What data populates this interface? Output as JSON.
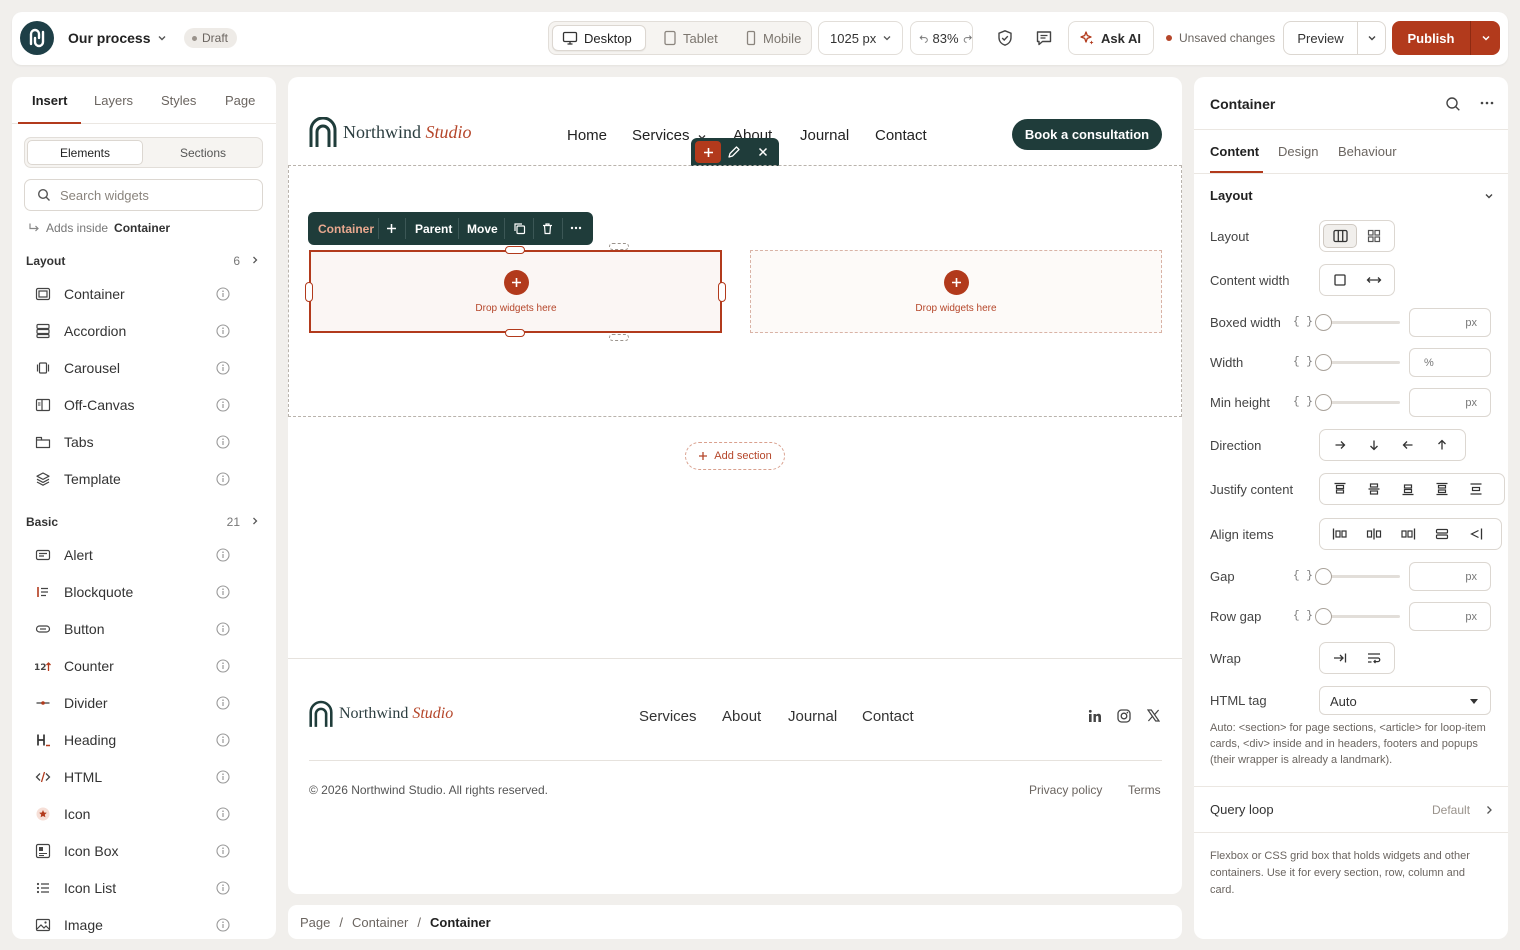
{
  "app": {
    "doc_title": "Our process",
    "status_badge": "Draft",
    "devices": [
      "Desktop",
      "Tablet",
      "Mobile"
    ],
    "width_value": "1025 px",
    "zoom": "83%",
    "ask_ai": "Ask AI",
    "unsaved": "Unsaved changes",
    "preview": "Preview",
    "publish": "Publish"
  },
  "left": {
    "tabs": [
      "Insert",
      "Layers",
      "Styles",
      "Page"
    ],
    "segments": [
      "Elements",
      "Sections"
    ],
    "search_placeholder": "Search widgets",
    "adds_inside_prefix": "Adds inside",
    "adds_inside_target": "Container",
    "layout_category": {
      "label": "Layout",
      "count": "6"
    },
    "layout_items": [
      "Container",
      "Accordion",
      "Carousel",
      "Off-Canvas",
      "Tabs",
      "Template"
    ],
    "basic_category": {
      "label": "Basic",
      "count": "21"
    },
    "basic_items": [
      "Alert",
      "Blockquote",
      "Button",
      "Counter",
      "Divider",
      "Heading",
      "HTML",
      "Icon",
      "Icon Box",
      "Icon List",
      "Image"
    ]
  },
  "site": {
    "brand_main": "Northwind",
    "brand_italic": "Studio",
    "nav": [
      "Home",
      "Services",
      "About",
      "Journal",
      "Contact"
    ],
    "cta": "Book a consultation",
    "toolbar": [
      "Container",
      "Parent",
      "Move"
    ],
    "drop_text": "Drop widgets here",
    "add_section": "Add section",
    "footer_nav": [
      "Services",
      "About",
      "Journal",
      "Contact"
    ],
    "copyright": "© 2026 Northwind Studio. All rights reserved.",
    "privacy": "Privacy policy",
    "terms": "Terms"
  },
  "breadcrumbs": [
    "Page",
    "Container",
    "Container"
  ],
  "right": {
    "title": "Container",
    "tabs": [
      "Content",
      "Design",
      "Behaviour"
    ],
    "section": "Layout",
    "labels": {
      "layout": "Layout",
      "content_width": "Content width",
      "boxed_width": "Boxed width",
      "width": "Width",
      "min_height": "Min height",
      "direction": "Direction",
      "justify": "Justify content",
      "align": "Align items",
      "gap": "Gap",
      "row_gap": "Row gap",
      "wrap": "Wrap",
      "html_tag": "HTML tag"
    },
    "units": {
      "boxed": "px",
      "width": "%",
      "min_height": "px",
      "gap": "px",
      "row_gap": "px"
    },
    "dynamic_tag": "{ }",
    "html_tag_value": "Auto",
    "html_note": "Auto: <section> for page sections, <article> for loop-item cards, <div> inside and in headers, footers and popups (their wrapper is already a landmark).",
    "query_loop": "Query loop",
    "query_default": "Default",
    "description": "Flexbox or CSS grid box that holds widgets and other containers. Use it for every section, row, column and card."
  },
  "colors": {
    "accent": "#b23a1c",
    "brand_dark": "#1f3c3a"
  }
}
